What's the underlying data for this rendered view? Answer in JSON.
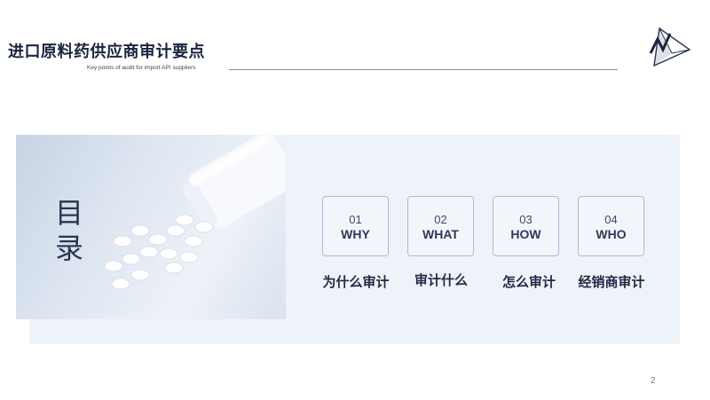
{
  "header": {
    "title": "进口原料药供应商审计要点",
    "subtitle": "Key points of audit for import API suppliers"
  },
  "toc": {
    "heading": "目录",
    "items": [
      {
        "num": "01",
        "word": "WHY",
        "caption": "为什么审计"
      },
      {
        "num": "02",
        "word": "WHAT",
        "caption": "审计什么"
      },
      {
        "num": "03",
        "word": "HOW",
        "caption": "怎么审计"
      },
      {
        "num": "04",
        "word": "WHO",
        "caption": "经销商审计"
      }
    ]
  },
  "footer": {
    "page_number": "2"
  },
  "colors": {
    "accent": "#1b2440",
    "panel": "#eef3fa",
    "card_border": "#a9bcd8"
  },
  "icons": {
    "logo": "triangle-logo-icon",
    "photo": "pill-bottle-image"
  }
}
